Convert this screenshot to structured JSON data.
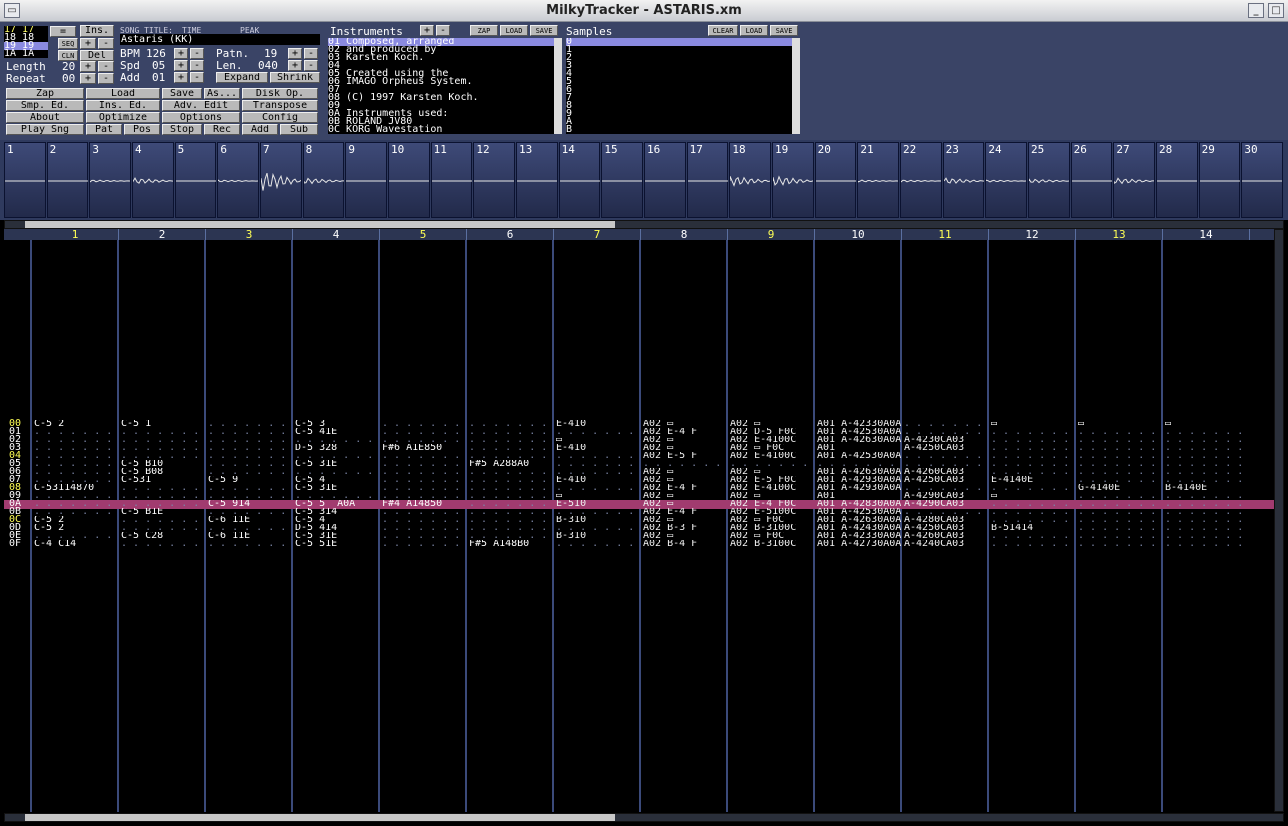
{
  "window": {
    "title": "MilkyTracker - ASTARIS.xm"
  },
  "orderlist": [
    "17 17",
    "18 18",
    "19 19",
    "1A 1A"
  ],
  "song": {
    "title_label": "SONG TITLE:",
    "title": "Astaris (KK)",
    "time_label": "TIME",
    "peak_label": "PEAK"
  },
  "length": {
    "label": "Length",
    "value": "20"
  },
  "repeat": {
    "label": "Repeat",
    "value": "00"
  },
  "bpm": {
    "label": "BPM",
    "value": "126"
  },
  "spd": {
    "label": "Spd",
    "value": "05"
  },
  "add": {
    "label": "Add",
    "value": "01"
  },
  "patn": {
    "label": "Patn.",
    "value": "19"
  },
  "len": {
    "label": "Len.",
    "value": "040"
  },
  "buttons": {
    "ins": "Ins.",
    "seq": "SEQ",
    "del": "Del",
    "cln": "CLN",
    "expand": "Expand",
    "shrink": "Shrink",
    "zap": "Zap",
    "load": "Load",
    "save": "Save",
    "as": "As...",
    "disk": "Disk Op.",
    "smp": "Smp. Ed.",
    "insed": "Ins. Ed.",
    "adv": "Adv. Edit",
    "transpose": "Transpose",
    "about": "About",
    "optimize": "Optimize",
    "options": "Options",
    "config": "Config",
    "playsng": "Play Sng",
    "pat": "Pat",
    "pos": "Pos",
    "stop": "Stop",
    "rec": "Rec",
    "addbtn": "Add",
    "sub": "Sub",
    "ins_zap": "ZAP",
    "ins_load": "LOAD",
    "ins_save": "SAVE",
    "smp_clear": "CLEAR",
    "smp_load": "LOAD",
    "smp_save": "SAVE"
  },
  "instruments": {
    "title": "Instruments",
    "items": [
      "01 Composed, arranged",
      "02 and produced by",
      "03 Karsten Koch.",
      "04",
      "05 Created using the",
      "06 IMAGO Orpheus System.",
      "07",
      "08 (C) 1997 Karsten Koch.",
      "09",
      "0A Instruments used:",
      "0B ROLAND JV80",
      "0C KORG Wavestation"
    ]
  },
  "samples": {
    "title": "Samples",
    "items": [
      "0",
      "1",
      "2",
      "3",
      "4",
      "5",
      "6",
      "7",
      "8",
      "9",
      "A",
      "B"
    ]
  },
  "scopes": [
    "1",
    "2",
    "3",
    "4",
    "5",
    "6",
    "7",
    "8",
    "9",
    "10",
    "11",
    "12",
    "13",
    "14",
    "15",
    "16",
    "17",
    "18",
    "19",
    "20",
    "21",
    "22",
    "23",
    "24",
    "25",
    "26",
    "27",
    "28",
    "29",
    "30"
  ],
  "channels": [
    "1",
    "2",
    "3",
    "4",
    "5",
    "6",
    "7",
    "8",
    "9",
    "10",
    "11",
    "12",
    "13",
    "14"
  ],
  "rows": [
    {
      "n": "00",
      "c": [
        "C-5 2",
        "C-5 1",
        "",
        "C-5 3",
        "",
        "",
        "E-410",
        "A02 ▭ ",
        "A02 ▭",
        "A01 A-42330A0A",
        "",
        "▭",
        "▭",
        "▭"
      ]
    },
    {
      "n": "01",
      "c": [
        "",
        "",
        "",
        "C-5 41E",
        "",
        "",
        "",
        "A02 E-4 F",
        "A02 D-5 F0C",
        "A01 A-42530A0A",
        "",
        "",
        "",
        ""
      ]
    },
    {
      "n": "02",
      "c": [
        "",
        "",
        "",
        "",
        "",
        "",
        "▭",
        "A02 ▭",
        "A02 E-4100C",
        "A01 A-42630A0A",
        "A-4230CA03",
        "",
        "",
        ""
      ]
    },
    {
      "n": "03",
      "c": [
        "",
        "",
        "",
        "D-5 328",
        "F#6 A1E850",
        "",
        "E-410",
        "A02 ▭",
        "A02 ▭ F0C",
        "A01",
        "A-4250CA03",
        "",
        "",
        ""
      ]
    },
    {
      "n": "04",
      "c": [
        "",
        "",
        "",
        "",
        "",
        "",
        "",
        "A02 E-5 F",
        "A02 E-4100C",
        "A01 A-42530A0A",
        "",
        "",
        "",
        ""
      ]
    },
    {
      "n": "05",
      "c": [
        "",
        "C-5 B10",
        "",
        "C-5 31E",
        "",
        "F#5 A288A0",
        "",
        "",
        "",
        "",
        "",
        "",
        "",
        ""
      ]
    },
    {
      "n": "06",
      "c": [
        "",
        "C-5 B08",
        "",
        "",
        "",
        "",
        "",
        "A02 ▭",
        "A02 ▭",
        "A01 A-42630A0A",
        "A-4260CA03",
        "",
        "",
        ""
      ]
    },
    {
      "n": "07",
      "c": [
        "",
        "C-531",
        "C-5 9",
        "C-5 4",
        "",
        "",
        "E-410",
        "A02 ▭",
        "A02 E-5 F0C",
        "A01 A-42930A0A",
        "A-4250CA03",
        "E-4140E",
        "",
        ""
      ]
    },
    {
      "n": "08",
      "c": [
        "C-53114870",
        "",
        "",
        "C-5 31E",
        "",
        "",
        "",
        "A02 E-4 F",
        "A02 E-4100C",
        "A01 A-42930A0A",
        "",
        "",
        "G-4140E",
        "B-4140E"
      ]
    },
    {
      "n": "09",
      "c": [
        "",
        "",
        "",
        "",
        "",
        "",
        "▭",
        "A02 ▭",
        "A02 ▭",
        "A01",
        "A-4290CA03",
        "▭",
        "",
        ""
      ]
    },
    {
      "n": "0A",
      "c": [
        "",
        "",
        "C-5 914",
        "C-5 5  A0A",
        "F#4 A14850",
        "",
        "E-510",
        "A02 ▭",
        "A02 E-4 F0C",
        "A01 A-42830A0A",
        "A-4290CA03",
        "",
        "",
        ""
      ]
    },
    {
      "n": "0B",
      "c": [
        "",
        "C-5 B1E",
        "",
        "C-5 314",
        "",
        "",
        "",
        "A02 E-4 F",
        "A02 E-5100C",
        "A01 A-42530A0A",
        "",
        "",
        "",
        ""
      ]
    },
    {
      "n": "0C",
      "c": [
        "C-5 2",
        "",
        "C-6 11E",
        "C-5 4",
        "",
        "",
        "B-310",
        "A02 ▭",
        "A02 ▭ F0C",
        "A01 A-42630A0A",
        "A-4280CA03",
        "",
        "",
        ""
      ]
    },
    {
      "n": "0D",
      "c": [
        "C-5 2",
        "",
        "",
        "D-5 414",
        "",
        "",
        "",
        "A02 B-3 F",
        "A02 B-3100C",
        "A01 A-42430A0A",
        "A-4250CA03",
        "B-51414",
        "",
        ""
      ]
    },
    {
      "n": "0E",
      "c": [
        "",
        "C-5 C28",
        "C-6 11E",
        "C-5 31E",
        "",
        "",
        "B-310",
        "A02 ▭",
        "A02 ▭ F0C",
        "A01 A-42330A0A",
        "A-4260CA03",
        "",
        "",
        ""
      ]
    },
    {
      "n": "0F",
      "c": [
        "C-4 C14",
        "",
        "",
        "C-5 51E",
        "",
        "F#5 A148B0",
        "",
        "A02 B-4 F",
        "A02 B-3100C",
        "A01 A-42730A0A",
        "A-4240CA03",
        "",
        "",
        ""
      ]
    }
  ]
}
